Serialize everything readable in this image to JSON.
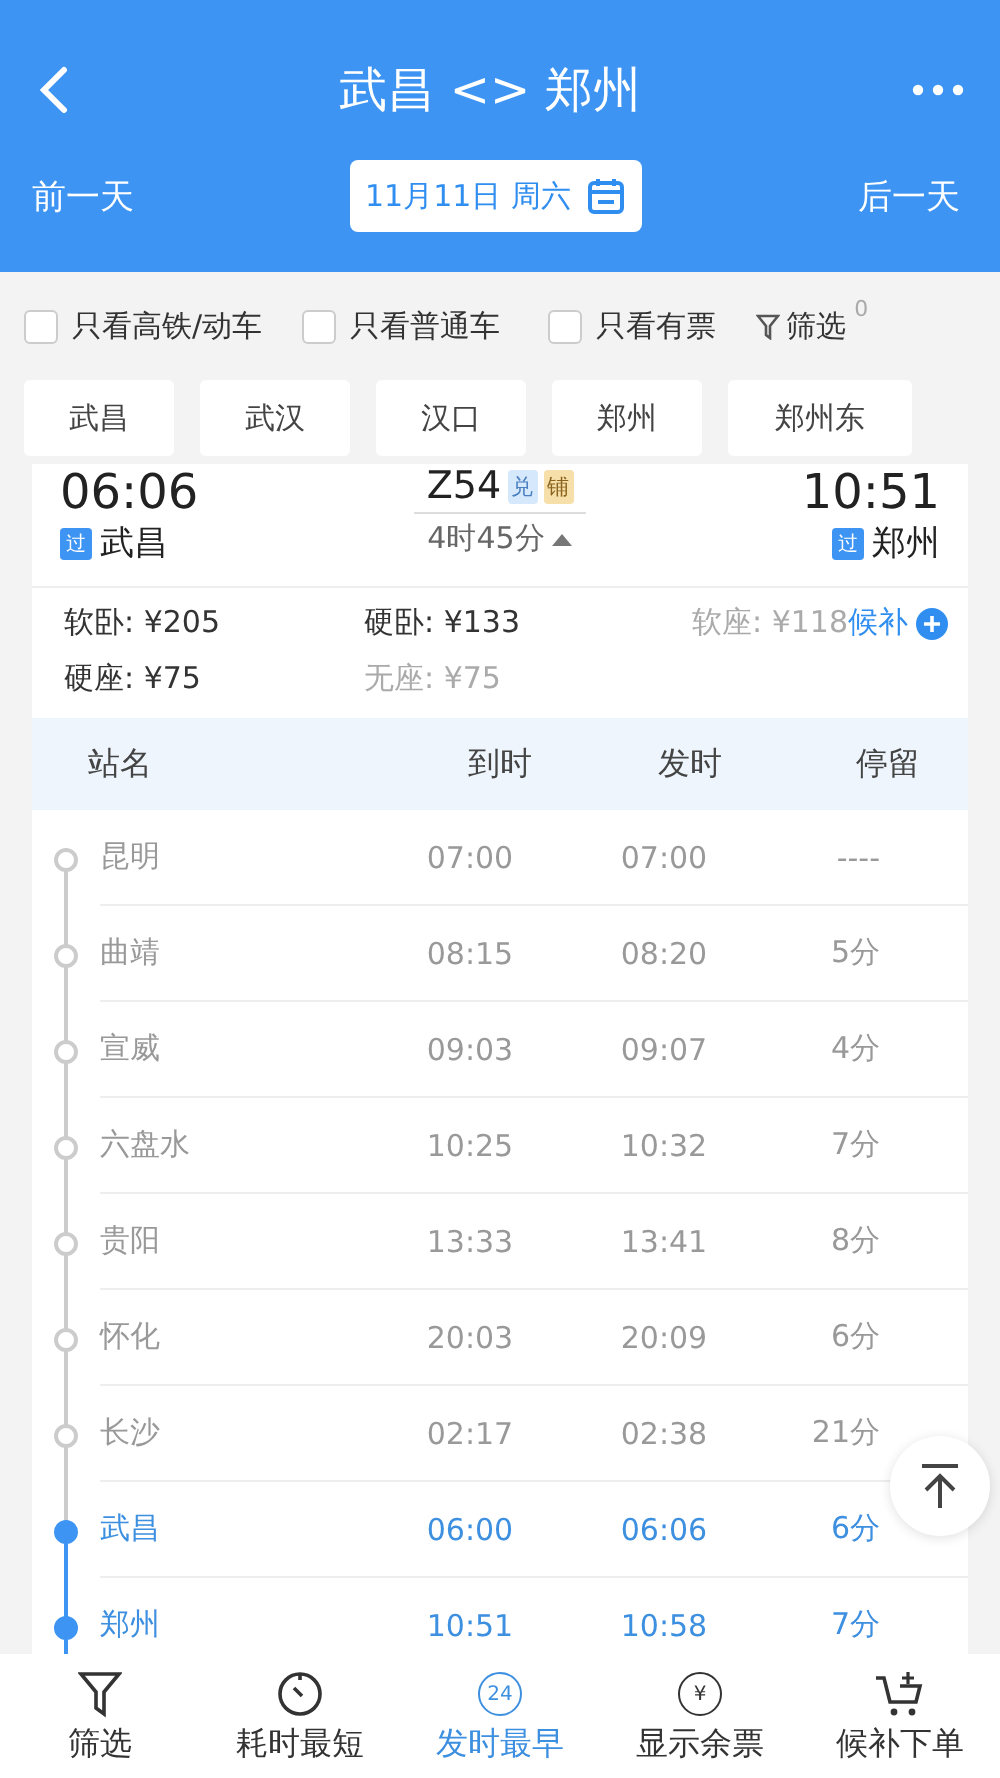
{
  "header": {
    "title": "武昌 <> 郑州",
    "prev_day": "前一天",
    "date": "11月11日 周六",
    "next_day": "后一天"
  },
  "filters": [
    {
      "label": "只看高铁/动车",
      "checked": false
    },
    {
      "label": "只看普通车",
      "checked": false
    },
    {
      "label": "只看有票",
      "checked": false
    }
  ],
  "filter_button": {
    "label": "筛选",
    "badge": "0"
  },
  "station_chips": [
    "武昌",
    "武汉",
    "汉口",
    "郑州",
    "郑州东"
  ],
  "train": {
    "depart_time": "06:06",
    "depart_station": "武昌",
    "depart_tag": "过",
    "number": "Z54",
    "tags": [
      {
        "label": "兑",
        "color": "#d6e8fb"
      },
      {
        "label": "铺",
        "color": "#f6dfa8"
      }
    ],
    "duration": "4时45分",
    "arrive_time": "10:51",
    "arrive_station": "郑州",
    "arrive_tag": "过"
  },
  "prices": [
    {
      "text": "软卧: ¥205",
      "available": true
    },
    {
      "text": "硬卧: ¥133",
      "available": true
    },
    {
      "text": "软座: ¥118",
      "available": false,
      "waitlist": "候补"
    },
    {
      "text": "硬座: ¥75",
      "available": true
    },
    {
      "text": "无座: ¥75",
      "available": false
    }
  ],
  "stops_table": {
    "columns": [
      "站名",
      "到时",
      "发时",
      "停留"
    ],
    "rows": [
      {
        "station": "昆明",
        "arrive": "07:00",
        "depart": "07:00",
        "stay": "----",
        "on_route": false
      },
      {
        "station": "曲靖",
        "arrive": "08:15",
        "depart": "08:20",
        "stay": "5分",
        "on_route": false
      },
      {
        "station": "宣威",
        "arrive": "09:03",
        "depart": "09:07",
        "stay": "4分",
        "on_route": false
      },
      {
        "station": "六盘水",
        "arrive": "10:25",
        "depart": "10:32",
        "stay": "7分",
        "on_route": false
      },
      {
        "station": "贵阳",
        "arrive": "13:33",
        "depart": "13:41",
        "stay": "8分",
        "on_route": false
      },
      {
        "station": "怀化",
        "arrive": "20:03",
        "depart": "20:09",
        "stay": "6分",
        "on_route": false
      },
      {
        "station": "长沙",
        "arrive": "02:17",
        "depart": "02:38",
        "stay": "21分",
        "on_route": false
      },
      {
        "station": "武昌",
        "arrive": "06:00",
        "depart": "06:06",
        "stay": "6分",
        "on_route": true
      },
      {
        "station": "郑州",
        "arrive": "10:51",
        "depart": "10:58",
        "stay": "7分",
        "on_route": true
      }
    ]
  },
  "bottom_tabs": [
    {
      "label": "筛选",
      "kind": "filter",
      "selected": false
    },
    {
      "label": "耗时最短",
      "kind": "clock",
      "selected": false
    },
    {
      "label": "发时最早",
      "kind": "badge24",
      "icon_text": "24",
      "selected": true
    },
    {
      "label": "显示余票",
      "kind": "yen",
      "icon_text": "¥",
      "selected": false
    },
    {
      "label": "候补下单",
      "kind": "cart",
      "selected": false
    }
  ]
}
